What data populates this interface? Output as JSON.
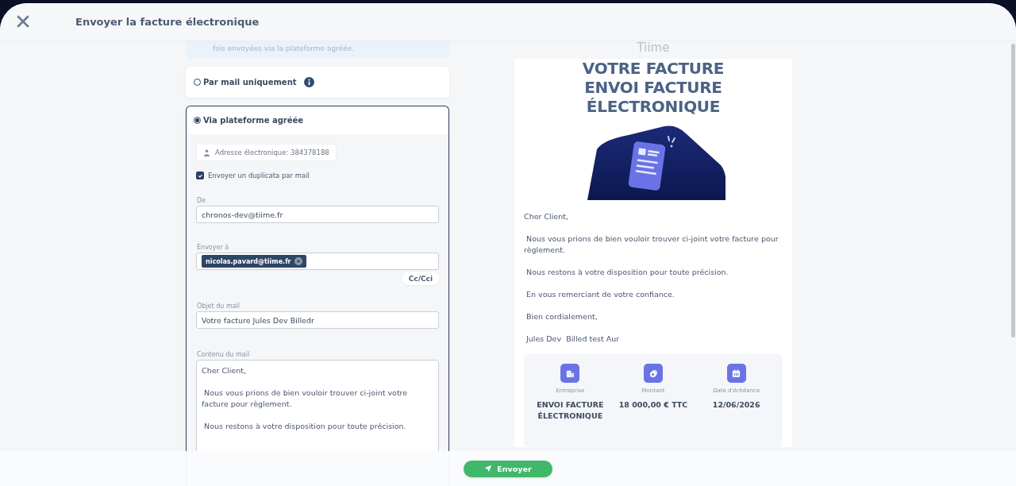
{
  "header": {
    "title": "Envoyer la facture électronique"
  },
  "info_note": {
    "text": "fois envoyées via la plateforme agréée."
  },
  "options": [
    {
      "label": "Par mail uniquement",
      "selected": false,
      "info": true
    },
    {
      "label": "Via plateforme agréée",
      "selected": true,
      "info": false
    }
  ],
  "platform": {
    "address": "Adresse électronique: 384378188",
    "duplicate": {
      "label": "Envoyer un duplicata par mail",
      "checked": true
    },
    "from": {
      "label": "De",
      "value": "chronos-dev@tiime.fr"
    },
    "to": {
      "label": "Envoyer à",
      "chips": [
        "nicolas.pavard@tiime.fr"
      ],
      "cc_button": "Cc/Cci"
    },
    "subject": {
      "label": "Objet du mail",
      "value": "Votre facture Jules Dev Billedr"
    },
    "body": {
      "label": "Contenu du mail",
      "paragraphs": [
        "Cher Client,",
        " Nous vous prions de bien vouloir trouver ci-joint votre facture pour règlement.",
        " Nous restons à votre disposition pour toute précision."
      ]
    }
  },
  "preview": {
    "logo": "Tiime",
    "heading": [
      "VOTRE FACTURE",
      "ENVOI FACTURE",
      "ÉLECTRONIQUE"
    ],
    "paragraphs": [
      "Cher Client,",
      " Nous vous prions de bien vouloir trouver ci-joint votre facture pour règlement.",
      " Nous restons à votre disposition pour toute précision.",
      " En vous remerciant de votre confiance.",
      " Bien cordialement,",
      " Jules Dev  Billed test Aur"
    ],
    "summary": [
      {
        "kind": "company",
        "label": "Entreprise",
        "value": "ENVOI FACTURE ÉLECTRONIQUE"
      },
      {
        "kind": "amount",
        "label": "Montant",
        "value": "18 000,00 € TTC"
      },
      {
        "kind": "date",
        "label": "Date d'échéance",
        "value": "12/06/2026"
      }
    ]
  },
  "footer": {
    "send_button": "Envoyer"
  }
}
